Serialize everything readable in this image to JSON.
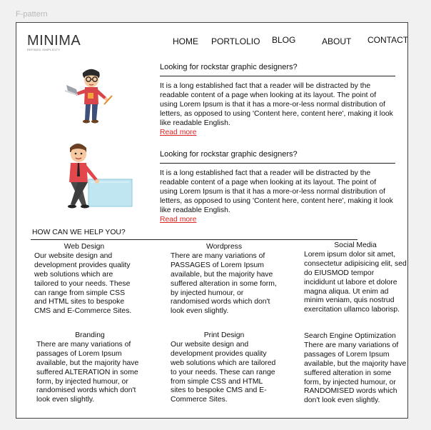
{
  "frame_label": "F-pattern",
  "logo": {
    "title": "MINIMA",
    "tagline": "REFINED SIMPLICITY"
  },
  "nav": [
    "HOME",
    "PORTLOLIO",
    "BLOG",
    "ABOUT",
    "CONTACT"
  ],
  "articles": [
    {
      "heading": "Looking for rockstar graphic designers?",
      "body": "It is a long established fact that a reader will be distracted by the readable content of a page when looking at its layout. The point of using Lorem Ipsum is that it has a more-or-less normal distribution of letters, as opposed to using 'Content here, content here', making it look like readable English.",
      "link": "Read more"
    },
    {
      "heading": "Looking for rockstar graphic designers?",
      "body": "It is a long established fact that a reader will be distracted by the readable content of a page when looking at its layout. The point of using Lorem Ipsum is that it has a more-or-less normal distribution of letters, as opposed to using 'Content here, content here', making it look like readable English.",
      "link": "Read more"
    }
  ],
  "help": {
    "title": "HOW CAN WE HELP YOU?"
  },
  "services": [
    {
      "title": "Web Design",
      "text": "Our website design and development provides quality web solutions which are tailored to your needs. These can range from simple CSS and HTML sites to bespoke CMS and E-Commerce Sites."
    },
    {
      "title": "Wordpress",
      "text": "There are many variations of PASSAGES of Lorem Ipsum available, but the majority have suffered alteration in some form, by injected humour, or randomised words which don't look even slightly."
    },
    {
      "title": "Social Media",
      "text": "Lorem ipsum dolor sit amet, consectetur adipisicing elit, sed do EIUSMOD tempor incididunt ut labore et dolore magna aliqua. Ut enim ad minim veniam, quis nostrud exercitation ullamco laborisp."
    },
    {
      "title": "Branding",
      "text": "There are many variations of passages of Lorem Ipsum available, but the majority have suffered ALTERATION in some form, by injected humour, or randomised words which don't look even slightly."
    },
    {
      "title": "Print Design",
      "text": "Our website design and development provides quality web solutions which are tailored to your needs. These can range from simple CSS and HTML sites to bespoke CMS and E-Commerce Sites."
    },
    {
      "title": "Search Engine Optimization",
      "text": "There are many variations of passages of Lorem Ipsum available, but the majority have suffered alteration in some form, by injected humour, or RANDOMISED words which don't look even slightly."
    }
  ],
  "colors": {
    "link": "#dd2222",
    "frame_border": "#444444",
    "background": "#f1f1f1"
  },
  "icons": [
    "designer-laptop-illustration",
    "designer-leaning-illustration"
  ]
}
